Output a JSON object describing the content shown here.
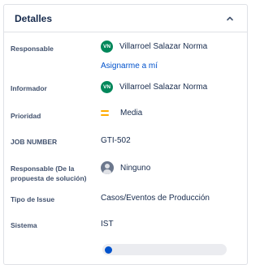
{
  "panel": {
    "title": "Detalles"
  },
  "fields": {
    "responsable": {
      "label": "Responsable",
      "avatar": "VN",
      "name": "Villarroel Salazar Norma",
      "assign_link": "Asignarme a mí"
    },
    "informador": {
      "label": "Informador",
      "avatar": "VN",
      "name": "Villarroel Salazar Norma"
    },
    "prioridad": {
      "label": "Prioridad",
      "value": "Media",
      "icon": "medium-priority-icon"
    },
    "job_number": {
      "label": "JOB NUMBER",
      "value": "GTI-502"
    },
    "responsable_propuesta": {
      "label": "Responsable (De la propuesta de solución)",
      "value": "Ninguno"
    },
    "tipo_issue": {
      "label": "Tipo de Issue",
      "value": "Casos/Eventos de Producción"
    },
    "sistema": {
      "label": "Sistema",
      "value": "IST"
    }
  },
  "colors": {
    "avatar_bg": "#00875a",
    "link": "#0052cc",
    "priority_medium": "#ffab00"
  }
}
